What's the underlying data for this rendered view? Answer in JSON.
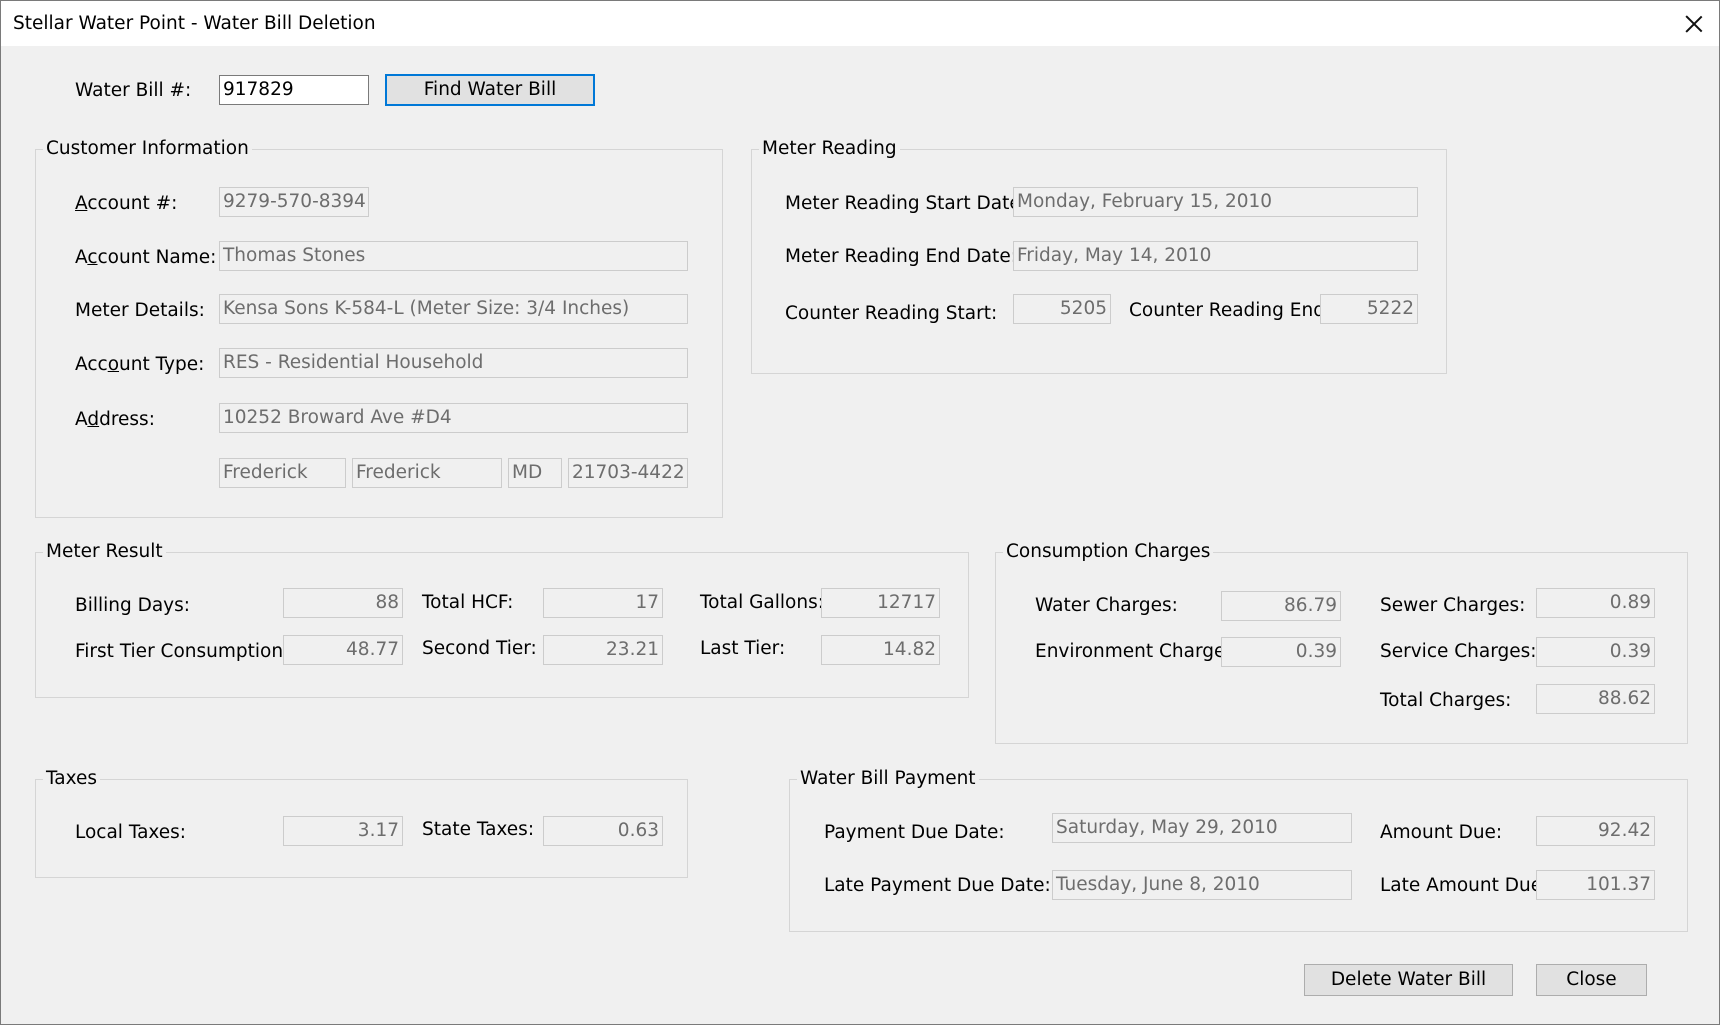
{
  "window": {
    "title": "Stellar Water Point - Water Bill Deletion"
  },
  "bill_search": {
    "label": "Water Bill #:",
    "value": "917829",
    "find_button": "Find Water Bill"
  },
  "customer_info": {
    "caption": "Customer Information",
    "account_number": {
      "label_pre": "",
      "label_key": "A",
      "label_post": "ccount #:",
      "value": "9279-570-8394"
    },
    "account_name": {
      "label_pre": "A",
      "label_key": "c",
      "label_post": "count Name:",
      "value": "Thomas Stones"
    },
    "meter_details": {
      "label": "Meter Details:",
      "value": "Kensa Sons K-584-L (Meter Size: 3/4 Inches)"
    },
    "account_type": {
      "label_pre": "Acc",
      "label_key": "o",
      "label_post": "unt Type:",
      "value": "RES - Residential Household"
    },
    "address": {
      "label_pre": "A",
      "label_key": "d",
      "label_post": "dress:",
      "value": "10252 Broward Ave #D4"
    },
    "city": "Frederick",
    "county": "Frederick",
    "state": "MD",
    "zip": "21703-4422"
  },
  "meter_reading": {
    "caption": "Meter Reading",
    "start_date": {
      "label": "Meter Reading Start Date:",
      "value": "Monday, February 15, 2010"
    },
    "end_date": {
      "label": "Meter Reading End Date:",
      "value": "Friday, May 14, 2010"
    },
    "counter_start": {
      "label": "Counter Reading Start:",
      "value": "5205"
    },
    "counter_end": {
      "label": "Counter Reading End:",
      "value": "5222"
    }
  },
  "meter_result": {
    "caption": "Meter Result",
    "billing_days": {
      "label": "Billing Days:",
      "value": "88"
    },
    "total_hcf": {
      "label": "Total HCF:",
      "value": "17"
    },
    "total_gallons": {
      "label": "Total Gallons:",
      "value": "12717"
    },
    "first_tier": {
      "label": "First Tier Consumption:",
      "value": "48.77"
    },
    "second_tier": {
      "label": "Second Tier:",
      "value": "23.21"
    },
    "last_tier": {
      "label": "Last Tier:",
      "value": "14.82"
    }
  },
  "consumption_charges": {
    "caption": "Consumption Charges",
    "water": {
      "label": "Water Charges:",
      "value": "86.79"
    },
    "sewer": {
      "label": "Sewer Charges:",
      "value": "0.89"
    },
    "environment": {
      "label": "Environment Charges:",
      "value": "0.39"
    },
    "service": {
      "label": "Service Charges:",
      "value": "0.39"
    },
    "total": {
      "label": "Total Charges:",
      "value": "88.62"
    }
  },
  "taxes": {
    "caption": "Taxes",
    "local": {
      "label": "Local Taxes:",
      "value": "3.17"
    },
    "state": {
      "label": "State Taxes:",
      "value": "0.63"
    }
  },
  "payment": {
    "caption": "Water Bill Payment",
    "due_date": {
      "label": "Payment Due Date:",
      "value": "Saturday, May 29, 2010"
    },
    "amount_due": {
      "label": "Amount Due:",
      "value": "92.42"
    },
    "late_due_date": {
      "label": "Late Payment Due Date:",
      "value": "Tuesday, June 8, 2010"
    },
    "late_amount_due": {
      "label": "Late Amount Due:",
      "value": "101.37"
    }
  },
  "buttons": {
    "delete": "Delete Water Bill",
    "close": "Close"
  },
  "colors": {
    "window_bg": "#f0f0f0",
    "titlebar_bg": "#ffffff",
    "readonly_text": "#6d6d6d",
    "focus_border": "#0078d7"
  },
  "icons": {
    "window_close": "close-icon"
  }
}
